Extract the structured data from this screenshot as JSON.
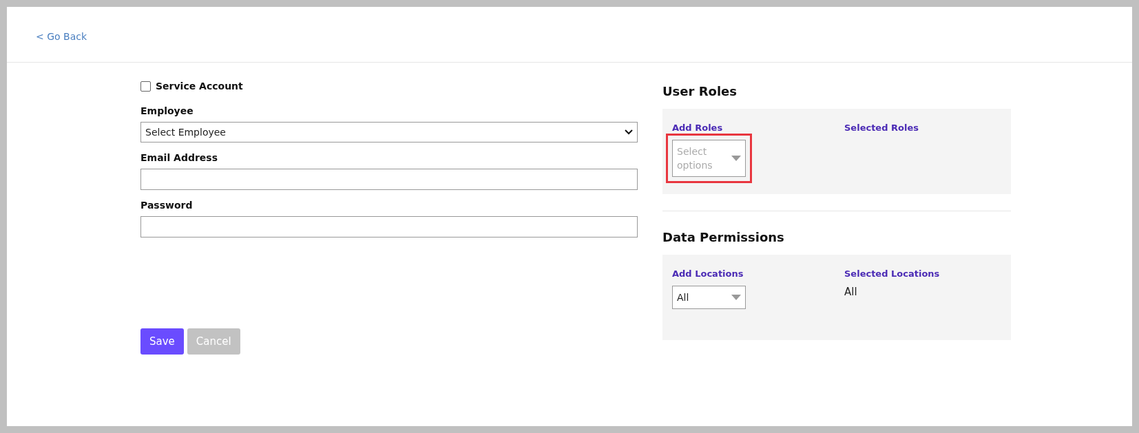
{
  "header": {
    "back_link": "< Go Back"
  },
  "form": {
    "service_account": {
      "label": "Service Account",
      "checked": false
    },
    "employee": {
      "label": "Employee",
      "value": "Select Employee"
    },
    "email": {
      "label": "Email Address"
    },
    "password": {
      "label": "Password"
    },
    "buttons": [
      {
        "label": "Save",
        "kind": "primary"
      },
      {
        "label": "Cancel",
        "kind": "disabled"
      }
    ]
  },
  "sections": [
    {
      "title": "User Roles",
      "add_label": "Add Roles",
      "selected_label": "Selected Roles",
      "dropdown": {
        "placeholder": "Select options",
        "highlighted": true
      }
    },
    {
      "title": "Data Permissions",
      "add_label": "Add Locations",
      "selected_label": "Selected Locations",
      "dropdown": {
        "value": "All",
        "highlighted": false
      },
      "selected_value": "All"
    }
  ]
}
